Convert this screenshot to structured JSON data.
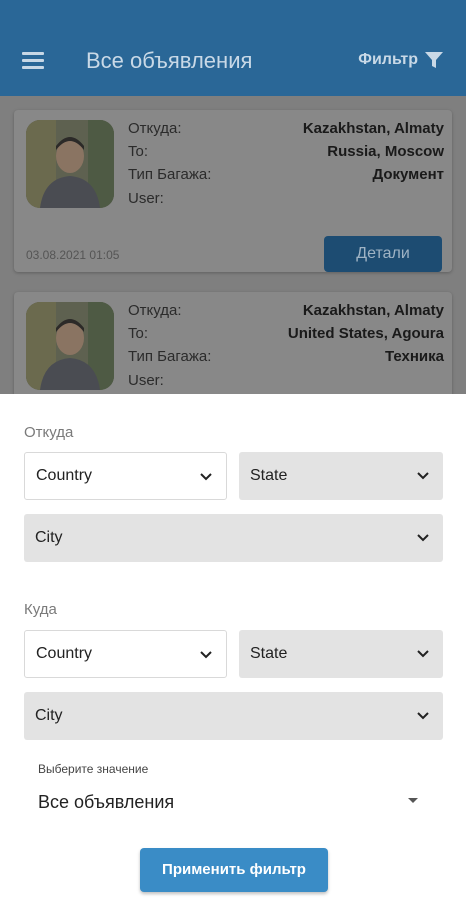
{
  "header": {
    "title": "Все объявления",
    "filter_label": "Фильтр",
    "menu_icon": "menu-icon",
    "filter_icon": "filter-icon",
    "color": "#2a6797"
  },
  "listings": [
    {
      "labels": {
        "from": "Откуда:",
        "to": "To:",
        "type": "Тип Багажа:",
        "user": "User:"
      },
      "from": "Kazakhstan, Almaty",
      "to": "Russia, Moscow",
      "type": "Документ",
      "user": "",
      "date": "03.08.2021 01:05",
      "details_label": "Детали"
    },
    {
      "labels": {
        "from": "Откуда:",
        "to": "To:",
        "type": "Тип Багажа:",
        "user": "User:"
      },
      "from": "Kazakhstan, Almaty",
      "to": "United States, Agoura",
      "type": "Техника",
      "user": ""
    }
  ],
  "filter": {
    "from_section": {
      "label": "Откуда",
      "country": "Country",
      "state": "State",
      "city": "City"
    },
    "to_section": {
      "label": "Куда",
      "country": "Country",
      "state": "State",
      "city": "City"
    },
    "type_select": {
      "label": "Выберите значение",
      "value": "Все объявления"
    },
    "apply_label": "Применить фильтр",
    "accent": "#3a8cc6"
  }
}
